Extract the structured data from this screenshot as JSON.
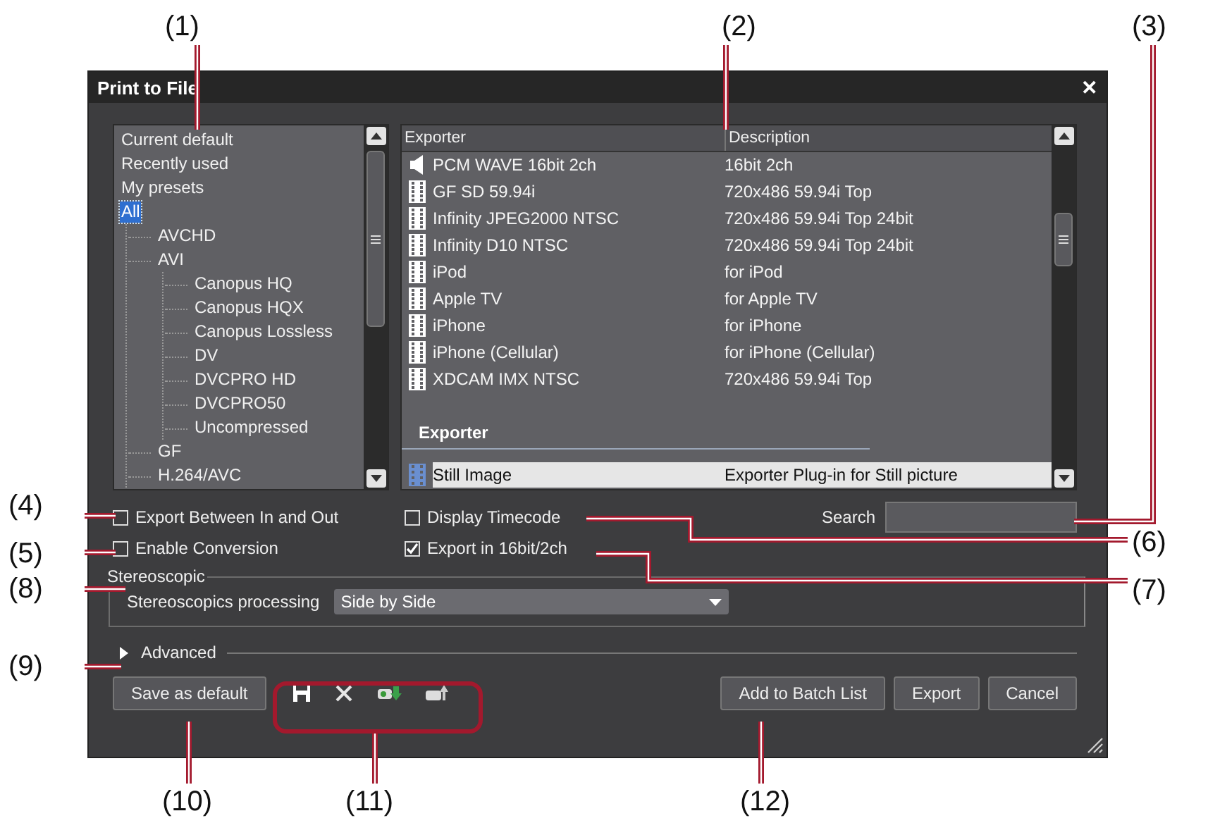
{
  "callouts": [
    "(1)",
    "(2)",
    "(3)",
    "(4)",
    "(5)",
    "(6)",
    "(7)",
    "(8)",
    "(9)",
    "(10)",
    "(11)",
    "(12)"
  ],
  "window": {
    "title": "Print to File",
    "close": "✕"
  },
  "preset_tree": [
    {
      "label": "Current default",
      "selected": false
    },
    {
      "label": "Recently used",
      "selected": false
    },
    {
      "label": "My presets",
      "selected": false
    },
    {
      "label": "All",
      "selected": true,
      "children": [
        {
          "label": "AVCHD",
          "selected": false
        },
        {
          "label": "AVI",
          "selected": false,
          "children": [
            {
              "label": "Canopus HQ",
              "selected": false
            },
            {
              "label": "Canopus HQX",
              "selected": false
            },
            {
              "label": "Canopus Lossless",
              "selected": false
            },
            {
              "label": "DV",
              "selected": false
            },
            {
              "label": "DVCPRO HD",
              "selected": false
            },
            {
              "label": "DVCPRO50",
              "selected": false
            },
            {
              "label": "Uncompressed",
              "selected": false
            }
          ]
        },
        {
          "label": "GF",
          "selected": false
        },
        {
          "label": "H.264/AVC",
          "selected": false
        }
      ]
    }
  ],
  "exporter_table": {
    "columns": [
      "Exporter",
      "Description"
    ],
    "rows": [
      {
        "kind": "audio",
        "exporter": "PCM WAVE 16bit 2ch",
        "description": "16bit 2ch",
        "selected": false
      },
      {
        "kind": "video",
        "exporter": "GF SD 59.94i",
        "description": "720x486 59.94i Top",
        "selected": false
      },
      {
        "kind": "video",
        "exporter": "Infinity JPEG2000 NTSC",
        "description": "720x486 59.94i Top 24bit",
        "selected": false
      },
      {
        "kind": "video",
        "exporter": "Infinity D10 NTSC",
        "description": "720x486 59.94i Top 24bit",
        "selected": false
      },
      {
        "kind": "video",
        "exporter": "iPod",
        "description": "for iPod",
        "selected": false
      },
      {
        "kind": "video",
        "exporter": "Apple TV",
        "description": "for Apple TV",
        "selected": false
      },
      {
        "kind": "video",
        "exporter": "iPhone",
        "description": "for iPhone",
        "selected": false
      },
      {
        "kind": "video",
        "exporter": "iPhone (Cellular)",
        "description": "for iPhone (Cellular)",
        "selected": false
      },
      {
        "kind": "video",
        "exporter": "XDCAM IMX NTSC",
        "description": "720x486 59.94i Top",
        "selected": false
      }
    ],
    "group": {
      "title": "Exporter",
      "rows": [
        {
          "kind": "still",
          "exporter": "Still Image",
          "description": "Exporter Plug-in for Still picture",
          "selected": true
        }
      ]
    }
  },
  "checkboxes": [
    {
      "label": "Export Between In and Out",
      "checked": false
    },
    {
      "label": "Display Timecode",
      "checked": false
    },
    {
      "label": "Enable Conversion",
      "checked": false
    },
    {
      "label": "Export in 16bit/2ch",
      "checked": true
    }
  ],
  "search": {
    "label": "Search"
  },
  "stereoscopic": {
    "title": "Stereoscopic",
    "label": "Stereoscopics processing",
    "value": "Side by Side"
  },
  "advanced": {
    "label": "Advanced",
    "expanded": false
  },
  "buttons_left": [
    {
      "label": "Save as default"
    }
  ],
  "toolbar": [
    {
      "kind": "save"
    },
    {
      "kind": "delete"
    },
    {
      "kind": "import"
    },
    {
      "kind": "export"
    }
  ],
  "buttons_right": [
    {
      "label": "Add to Batch List"
    },
    {
      "label": "Export"
    },
    {
      "label": "Cancel"
    }
  ]
}
